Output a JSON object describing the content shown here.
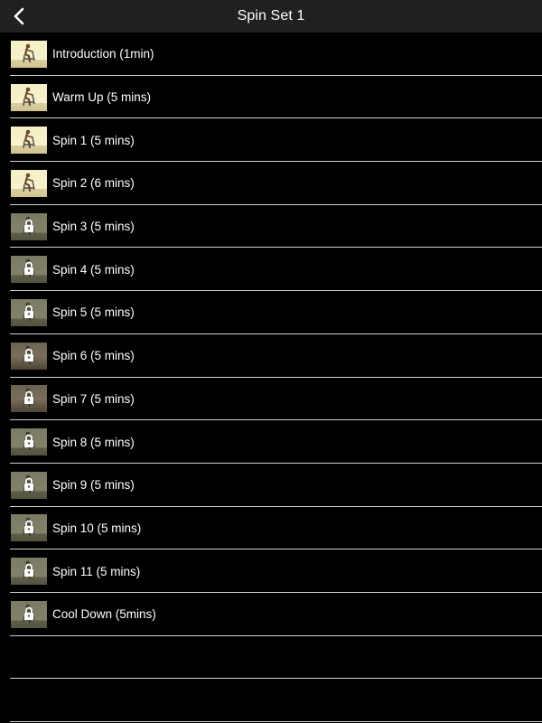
{
  "nav": {
    "title": "Spin Set 1",
    "back_icon": "chevron-left-icon"
  },
  "items": [
    {
      "label": "Introduction (1min)",
      "locked": false
    },
    {
      "label": "Warm Up (5 mins)",
      "locked": false
    },
    {
      "label": "Spin 1 (5 mins)",
      "locked": false
    },
    {
      "label": "Spin 2 (6 mins)",
      "locked": false
    },
    {
      "label": "Spin 3 (5 mins)",
      "locked": true
    },
    {
      "label": "Spin 4 (5 mins)",
      "locked": true
    },
    {
      "label": "Spin 5 (5 mins)",
      "locked": true
    },
    {
      "label": "Spin 6 (5 mins)",
      "locked": true
    },
    {
      "label": "Spin 7 (5 mins)",
      "locked": true
    },
    {
      "label": "Spin 8 (5 mins)",
      "locked": true
    },
    {
      "label": "Spin 9 (5 mins)",
      "locked": true
    },
    {
      "label": "Spin 10 (5 mins)",
      "locked": true
    },
    {
      "label": "Spin 11 (5 mins)",
      "locked": true
    },
    {
      "label": "Cool Down (5mins)",
      "locked": true
    }
  ],
  "colors": {
    "background": "#000000",
    "nav_bar": "#1e1e1e",
    "separator": "#cfcfcf",
    "text": "#ffffff"
  }
}
